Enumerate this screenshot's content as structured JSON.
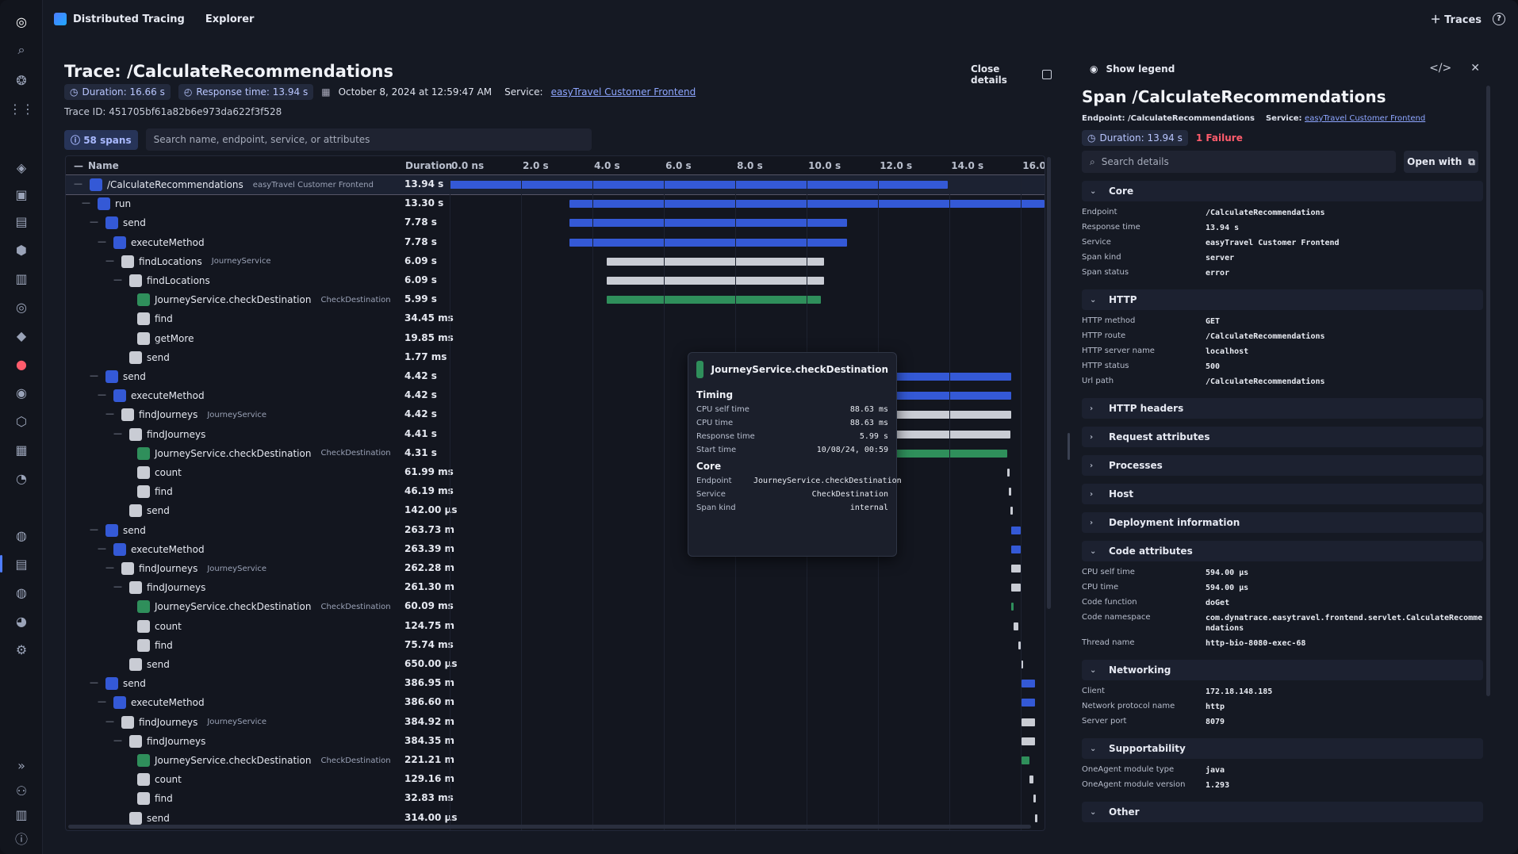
{
  "topbar": {
    "app_name": "Distributed Tracing",
    "tab": "Explorer",
    "traces_label": "Traces"
  },
  "trace": {
    "title": "Trace: /CalculateRecommendations",
    "duration": "Duration: 16.66 s",
    "response_time": "Response time: 13.94 s",
    "date": "October 8, 2024 at 12:59:47 AM",
    "service_label": "Service:",
    "service": "easyTravel Customer Frontend",
    "trace_id": "Trace ID: 451705bf61a82b6e973da622f3f528",
    "spans_count": "58 spans",
    "search_placeholder": "Search name, endpoint, service, or attributes",
    "close_details": "Close details"
  },
  "table": {
    "col_name": "Name",
    "col_duration": "Duration",
    "ticks": [
      "0.0 ns",
      "2.0 s",
      "4.0 s",
      "6.0 s",
      "8.0 s",
      "10.0 s",
      "12.0 s",
      "14.0 s",
      "16.0 s"
    ],
    "rows": [
      {
        "name": "/CalculateRecommendations",
        "svc": "easyTravel Customer Frontend",
        "dur": "13.94 s",
        "lvl": 0,
        "type": "blue",
        "start": 0,
        "end": 13.94,
        "sel": true
      },
      {
        "name": "run",
        "svc": "",
        "dur": "13.30 s",
        "lvl": 1,
        "type": "blue",
        "start": 3.36,
        "end": 16.66
      },
      {
        "name": "send",
        "svc": "",
        "dur": "7.78 s",
        "lvl": 2,
        "type": "blue",
        "start": 3.36,
        "end": 11.14
      },
      {
        "name": "executeMethod",
        "svc": "",
        "dur": "7.78 s",
        "lvl": 3,
        "type": "blue",
        "start": 3.36,
        "end": 11.14
      },
      {
        "name": "findLocations",
        "svc": "JourneyService",
        "dur": "6.09 s",
        "lvl": 4,
        "type": "white",
        "start": 4.4,
        "end": 10.49
      },
      {
        "name": "findLocations",
        "svc": "",
        "dur": "6.09 s",
        "lvl": 5,
        "type": "white",
        "start": 4.4,
        "end": 10.49
      },
      {
        "name": "JourneyService.checkDestination",
        "svc": "CheckDestination",
        "dur": "5.99 s",
        "lvl": 6,
        "type": "green",
        "start": 4.4,
        "end": 10.39
      },
      {
        "name": "find",
        "svc": "",
        "dur": "34.45 ms",
        "lvl": 6,
        "type": "white",
        "start": 0,
        "end": 0
      },
      {
        "name": "getMore",
        "svc": "",
        "dur": "19.85 ms",
        "lvl": 6,
        "type": "white",
        "start": 0,
        "end": 0
      },
      {
        "name": "send",
        "svc": "",
        "dur": "1.77 ms",
        "lvl": 5,
        "type": "white",
        "start": 0,
        "end": 0
      },
      {
        "name": "send",
        "svc": "",
        "dur": "4.42 s",
        "lvl": 2,
        "type": "blue",
        "start": 11.3,
        "end": 15.72
      },
      {
        "name": "executeMethod",
        "svc": "",
        "dur": "4.42 s",
        "lvl": 3,
        "type": "blue",
        "start": 11.3,
        "end": 15.72
      },
      {
        "name": "findJourneys",
        "svc": "JourneyService",
        "dur": "4.42 s",
        "lvl": 4,
        "type": "white",
        "start": 11.3,
        "end": 15.72
      },
      {
        "name": "findJourneys",
        "svc": "",
        "dur": "4.41 s",
        "lvl": 5,
        "type": "white",
        "start": 11.3,
        "end": 15.71
      },
      {
        "name": "JourneyService.checkDestination",
        "svc": "CheckDestination",
        "dur": "4.31 s",
        "lvl": 6,
        "type": "green",
        "start": 11.3,
        "end": 15.61
      },
      {
        "name": "count",
        "svc": "",
        "dur": "61.99 ms",
        "lvl": 6,
        "type": "white",
        "start": 15.62,
        "end": 15.68
      },
      {
        "name": "find",
        "svc": "",
        "dur": "46.19 ms",
        "lvl": 6,
        "type": "white",
        "start": 15.66,
        "end": 15.71
      },
      {
        "name": "send",
        "svc": "",
        "dur": "142.00 µs",
        "lvl": 5,
        "type": "white",
        "start": 15.71,
        "end": 15.72
      },
      {
        "name": "send",
        "svc": "",
        "dur": "263.73 m",
        "lvl": 2,
        "type": "blue",
        "start": 15.73,
        "end": 15.99
      },
      {
        "name": "executeMethod",
        "svc": "",
        "dur": "263.39 m",
        "lvl": 3,
        "type": "blue",
        "start": 15.73,
        "end": 15.99
      },
      {
        "name": "findJourneys",
        "svc": "JourneyService",
        "dur": "262.28 m",
        "lvl": 4,
        "type": "white",
        "start": 15.73,
        "end": 15.99
      },
      {
        "name": "findJourneys",
        "svc": "",
        "dur": "261.30 m",
        "lvl": 5,
        "type": "white",
        "start": 15.73,
        "end": 15.99
      },
      {
        "name": "JourneyService.checkDestination",
        "svc": "CheckDestination",
        "dur": "60.09 ms",
        "lvl": 6,
        "type": "green",
        "start": 15.73,
        "end": 15.79
      },
      {
        "name": "count",
        "svc": "",
        "dur": "124.75 m",
        "lvl": 6,
        "type": "white",
        "start": 15.8,
        "end": 15.92
      },
      {
        "name": "find",
        "svc": "",
        "dur": "75.74 ms",
        "lvl": 6,
        "type": "white",
        "start": 15.92,
        "end": 15.99
      },
      {
        "name": "send",
        "svc": "",
        "dur": "650.00 µs",
        "lvl": 5,
        "type": "white",
        "start": 15.99,
        "end": 16.0
      },
      {
        "name": "send",
        "svc": "",
        "dur": "386.95 m",
        "lvl": 2,
        "type": "blue",
        "start": 16.01,
        "end": 16.4
      },
      {
        "name": "executeMethod",
        "svc": "",
        "dur": "386.60 m",
        "lvl": 3,
        "type": "blue",
        "start": 16.01,
        "end": 16.4
      },
      {
        "name": "findJourneys",
        "svc": "JourneyService",
        "dur": "384.92 m",
        "lvl": 4,
        "type": "white",
        "start": 16.01,
        "end": 16.4
      },
      {
        "name": "findJourneys",
        "svc": "",
        "dur": "384.35 m",
        "lvl": 5,
        "type": "white",
        "start": 16.01,
        "end": 16.39
      },
      {
        "name": "JourneyService.checkDestination",
        "svc": "CheckDestination",
        "dur": "221.21 m",
        "lvl": 6,
        "type": "green",
        "start": 16.01,
        "end": 16.23
      },
      {
        "name": "count",
        "svc": "",
        "dur": "129.16 m",
        "lvl": 6,
        "type": "white",
        "start": 16.23,
        "end": 16.36
      },
      {
        "name": "find",
        "svc": "",
        "dur": "32.83 ms",
        "lvl": 6,
        "type": "white",
        "start": 16.36,
        "end": 16.39
      },
      {
        "name": "send",
        "svc": "",
        "dur": "314.00 µs",
        "lvl": 5,
        "type": "white",
        "start": 16.39,
        "end": 16.4
      }
    ]
  },
  "tooltip": {
    "title": "JourneyService.checkDestination",
    "timing_label": "Timing",
    "timing": [
      [
        "CPU self time",
        "88.63 ms"
      ],
      [
        "CPU time",
        "88.63 ms"
      ],
      [
        "Response time",
        "5.99 s"
      ],
      [
        "Start time",
        "10/08/24, 00:59"
      ]
    ],
    "core_label": "Core",
    "core": [
      [
        "Endpoint",
        "JourneyService.checkDestination"
      ],
      [
        "Service",
        "CheckDestination"
      ],
      [
        "Span kind",
        "internal"
      ]
    ]
  },
  "panel": {
    "show_legend": "Show legend",
    "title": "Span /CalculateRecommendations",
    "endpoint_label": "Endpoint:",
    "endpoint": "/CalculateRecommendations",
    "service_label": "Service:",
    "service": "easyTravel Customer Frontend",
    "duration": "Duration: 13.94 s",
    "failure": "1 Failure",
    "search_placeholder": "Search details",
    "open_with": "Open with",
    "sections": [
      {
        "label": "Core",
        "open": true,
        "items": [
          [
            "Endpoint",
            "/CalculateRecommendations"
          ],
          [
            "Response time",
            "13.94 s"
          ],
          [
            "Service",
            "easyTravel Customer Frontend"
          ],
          [
            "Span kind",
            "server"
          ],
          [
            "Span status",
            "error"
          ]
        ]
      },
      {
        "label": "HTTP",
        "open": true,
        "items": [
          [
            "HTTP method",
            "GET"
          ],
          [
            "HTTP route",
            "/CalculateRecommendations"
          ],
          [
            "HTTP server name",
            "localhost"
          ],
          [
            "HTTP status",
            "500"
          ],
          [
            "Url path",
            "/CalculateRecommendations"
          ]
        ]
      },
      {
        "label": "HTTP headers",
        "open": false,
        "items": []
      },
      {
        "label": "Request attributes",
        "open": false,
        "items": []
      },
      {
        "label": "Processes",
        "open": false,
        "items": []
      },
      {
        "label": "Host",
        "open": false,
        "items": []
      },
      {
        "label": "Deployment information",
        "open": false,
        "items": []
      },
      {
        "label": "Code attributes",
        "open": true,
        "items": [
          [
            "CPU self time",
            "594.00 µs"
          ],
          [
            "CPU time",
            "594.00 µs"
          ],
          [
            "Code function",
            "doGet"
          ],
          [
            "Code namespace",
            "com.dynatrace.easytravel.frontend.servlet.CalculateRecommendations"
          ],
          [
            "Thread name",
            "http-bio-8080-exec-68"
          ]
        ]
      },
      {
        "label": "Networking",
        "open": true,
        "items": [
          [
            "Client",
            "172.18.148.185"
          ],
          [
            "Network protocol name",
            "http"
          ],
          [
            "Server port",
            "8079"
          ]
        ]
      },
      {
        "label": "Supportability",
        "open": true,
        "items": [
          [
            "OneAgent module type",
            "java"
          ],
          [
            "OneAgent module version",
            "1.293"
          ]
        ]
      },
      {
        "label": "Other",
        "open": true,
        "items": []
      }
    ]
  },
  "colors": {
    "blue": "#3459d6",
    "white": "#d4d7de",
    "green": "#2f8f5b",
    "accent": "#8ea6ff",
    "failure": "#ff5c6c"
  },
  "sidebar_icons": [
    "dynatrace-logo-icon",
    "search-icon",
    "ai-icon",
    "apps-grid-icon",
    "cube-icon",
    "chart-icon",
    "dashboard-icon",
    "kubernetes-icon",
    "monitor-icon",
    "glasses-icon",
    "shield-icon",
    "alert-icon",
    "record-icon",
    "hexagon-icon",
    "database-icon",
    "clock-icon",
    "globe-icon",
    "tracing-icon",
    "search-app-icon",
    "notebook-icon",
    "settings-icon",
    "expand-icon",
    "help-icon",
    "account-icon",
    "info-icon"
  ]
}
